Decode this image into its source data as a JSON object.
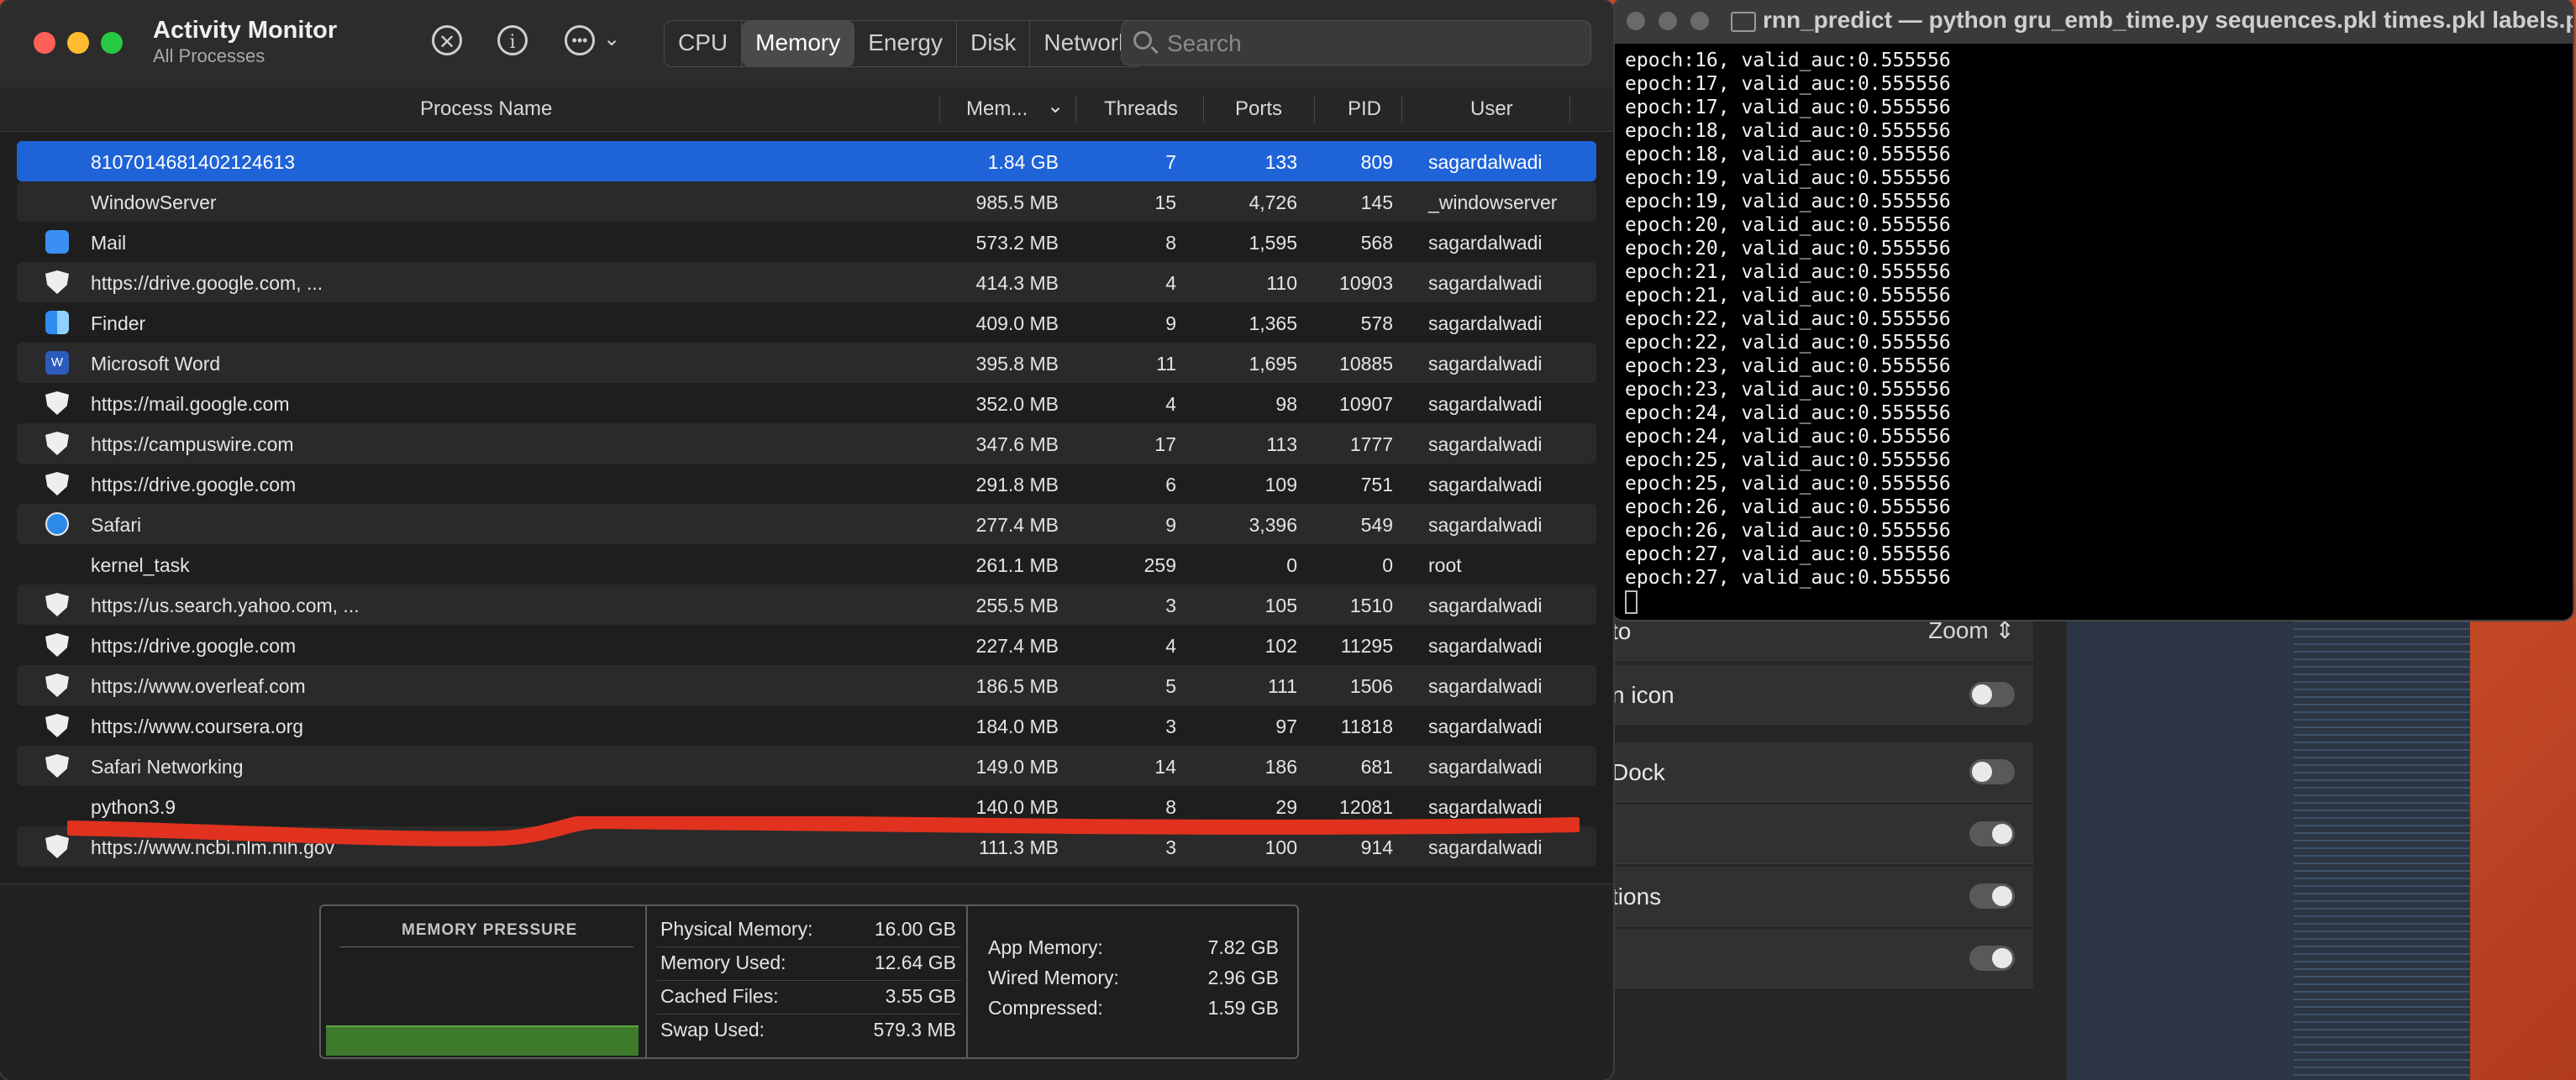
{
  "settings_bg": {
    "zoom_label": "Zoom",
    "rows": [
      {
        "label": "to",
        "control": "zoom"
      },
      {
        "label": "n icon",
        "control": "toggle-off"
      },
      {
        "label": "Dock",
        "control": "toggle-off"
      },
      {
        "label": "",
        "control": "toggle-on"
      },
      {
        "label": "tions",
        "control": "toggle-on"
      },
      {
        "label": "",
        "control": "toggle-on"
      }
    ]
  },
  "terminal": {
    "title": "rnn_predict — python gru_emb_time.py sequences.pkl times.pkl labels.p...",
    "lines": [
      "epoch:16, valid_auc:0.555556",
      "epoch:17, valid_auc:0.555556",
      "epoch:17, valid_auc:0.555556",
      "epoch:18, valid_auc:0.555556",
      "epoch:18, valid_auc:0.555556",
      "epoch:19, valid_auc:0.555556",
      "epoch:19, valid_auc:0.555556",
      "epoch:20, valid_auc:0.555556",
      "epoch:20, valid_auc:0.555556",
      "epoch:21, valid_auc:0.555556",
      "epoch:21, valid_auc:0.555556",
      "epoch:22, valid_auc:0.555556",
      "epoch:22, valid_auc:0.555556",
      "epoch:23, valid_auc:0.555556",
      "epoch:23, valid_auc:0.555556",
      "epoch:24, valid_auc:0.555556",
      "epoch:24, valid_auc:0.555556",
      "epoch:25, valid_auc:0.555556",
      "epoch:25, valid_auc:0.555556",
      "epoch:26, valid_auc:0.555556",
      "epoch:26, valid_auc:0.555556",
      "epoch:27, valid_auc:0.555556",
      "epoch:27, valid_auc:0.555556"
    ]
  },
  "activity_monitor": {
    "title": "Activity Monitor",
    "subtitle": "All Processes",
    "toolbar_icons": [
      "stop-process-icon",
      "info-icon",
      "more-actions-icon",
      "chevron-down-icon"
    ],
    "tabs": [
      {
        "label": "CPU",
        "active": false
      },
      {
        "label": "Memory",
        "active": true
      },
      {
        "label": "Energy",
        "active": false
      },
      {
        "label": "Disk",
        "active": false
      },
      {
        "label": "Network",
        "active": false
      }
    ],
    "search": {
      "placeholder": "Search",
      "value": ""
    },
    "columns": {
      "name": "Process Name",
      "memory": "Mem...",
      "threads": "Threads",
      "ports": "Ports",
      "pid": "PID",
      "user": "User"
    },
    "sort_indicator": "⌄",
    "processes": [
      {
        "icon": "none",
        "name": "8107014681402124613",
        "memory": "1.84 GB",
        "threads": "7",
        "ports": "133",
        "pid": "809",
        "user": "sagardalwadi",
        "selected": true
      },
      {
        "icon": "none",
        "name": "WindowServer",
        "memory": "985.5 MB",
        "threads": "15",
        "ports": "4,726",
        "pid": "145",
        "user": "_windowserver"
      },
      {
        "icon": "mail-icon",
        "name": "Mail",
        "memory": "573.2 MB",
        "threads": "8",
        "ports": "1,595",
        "pid": "568",
        "user": "sagardalwadi"
      },
      {
        "icon": "shield-icon",
        "name": "https://drive.google.com, ...",
        "memory": "414.3 MB",
        "threads": "4",
        "ports": "110",
        "pid": "10903",
        "user": "sagardalwadi"
      },
      {
        "icon": "finder-icon",
        "name": "Finder",
        "memory": "409.0 MB",
        "threads": "9",
        "ports": "1,365",
        "pid": "578",
        "user": "sagardalwadi"
      },
      {
        "icon": "word-icon",
        "name": "Microsoft Word",
        "memory": "395.8 MB",
        "threads": "11",
        "ports": "1,695",
        "pid": "10885",
        "user": "sagardalwadi"
      },
      {
        "icon": "shield-icon",
        "name": "https://mail.google.com",
        "memory": "352.0 MB",
        "threads": "4",
        "ports": "98",
        "pid": "10907",
        "user": "sagardalwadi"
      },
      {
        "icon": "shield-icon",
        "name": "https://campuswire.com",
        "memory": "347.6 MB",
        "threads": "17",
        "ports": "113",
        "pid": "1777",
        "user": "sagardalwadi"
      },
      {
        "icon": "shield-icon",
        "name": "https://drive.google.com",
        "memory": "291.8 MB",
        "threads": "6",
        "ports": "109",
        "pid": "751",
        "user": "sagardalwadi"
      },
      {
        "icon": "safari-icon",
        "name": "Safari",
        "memory": "277.4 MB",
        "threads": "9",
        "ports": "3,396",
        "pid": "549",
        "user": "sagardalwadi"
      },
      {
        "icon": "none",
        "name": "kernel_task",
        "memory": "261.1 MB",
        "threads": "259",
        "ports": "0",
        "pid": "0",
        "user": "root"
      },
      {
        "icon": "shield-icon",
        "name": "https://us.search.yahoo.com, ...",
        "memory": "255.5 MB",
        "threads": "3",
        "ports": "105",
        "pid": "1510",
        "user": "sagardalwadi"
      },
      {
        "icon": "shield-icon",
        "name": "https://drive.google.com",
        "memory": "227.4 MB",
        "threads": "4",
        "ports": "102",
        "pid": "11295",
        "user": "sagardalwadi"
      },
      {
        "icon": "shield-icon",
        "name": "https://www.overleaf.com",
        "memory": "186.5 MB",
        "threads": "5",
        "ports": "111",
        "pid": "1506",
        "user": "sagardalwadi"
      },
      {
        "icon": "shield-icon",
        "name": "https://www.coursera.org",
        "memory": "184.0 MB",
        "threads": "3",
        "ports": "97",
        "pid": "11818",
        "user": "sagardalwadi"
      },
      {
        "icon": "shield-icon",
        "name": "Safari Networking",
        "memory": "149.0 MB",
        "threads": "14",
        "ports": "186",
        "pid": "681",
        "user": "sagardalwadi"
      },
      {
        "icon": "none",
        "name": "python3.9",
        "memory": "140.0 MB",
        "threads": "8",
        "ports": "29",
        "pid": "12081",
        "user": "sagardalwadi"
      },
      {
        "icon": "shield-icon",
        "name": "https://www.ncbi.nlm.nih.gov",
        "memory": "111.3 MB",
        "threads": "3",
        "ports": "100",
        "pid": "914",
        "user": "sagardalwadi"
      }
    ],
    "memory_pressure": {
      "title": "MEMORY PRESSURE",
      "color": "#3d7a2b",
      "stats_left": [
        {
          "label": "Physical Memory:",
          "value": "16.00 GB"
        },
        {
          "label": "Memory Used:",
          "value": "12.64 GB"
        },
        {
          "label": "Cached Files:",
          "value": "3.55 GB"
        },
        {
          "label": "Swap Used:",
          "value": "579.3 MB"
        }
      ],
      "stats_right": [
        {
          "label": "App Memory:",
          "value": "7.82 GB"
        },
        {
          "label": "Wired Memory:",
          "value": "2.96 GB"
        },
        {
          "label": "Compressed:",
          "value": "1.59 GB"
        }
      ]
    }
  },
  "colors": {
    "selection": "#1f63d8",
    "annotation_stroke": "#e0321e"
  }
}
